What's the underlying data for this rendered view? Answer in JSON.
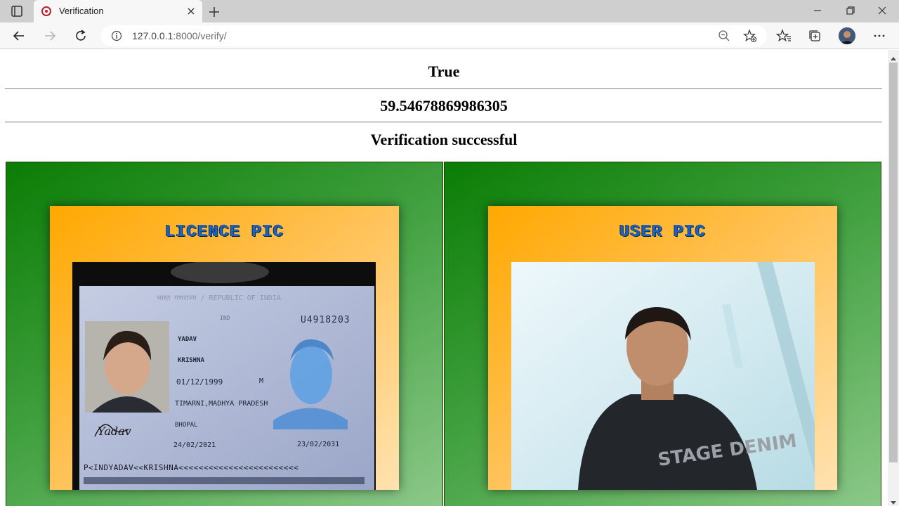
{
  "browser": {
    "tab_title": "Verification",
    "url_host": "127.0.0.1",
    "url_rest": ":8000/verify/"
  },
  "page": {
    "result": "True",
    "score": "59.54678869986305",
    "message": "Verification successful",
    "licence_title": "LICENCE PIC",
    "user_title": "USER PIC"
  },
  "licence_card": {
    "header": "भारत गणराज्य / REPUBLIC OF INDIA",
    "number": "U4918203",
    "surname": "YADAV",
    "given_name": "KRISHNA",
    "dob": "01/12/1999",
    "sex": "M",
    "place_of_birth": "TIMARNI,MADHYA PRADESH",
    "place_of_issue": "BHOPAL",
    "issue_date": "24/02/2021",
    "expiry_date": "23/02/2031",
    "mrz": "P<INDYADAV<<KRISHNA<<<<<<<<<<<<<<<<<<<<<<<<",
    "country": "IND",
    "signature": "Yadav"
  },
  "user_photo": {
    "shirt_text": "STAGE DENIM"
  },
  "colors": {
    "panel_green": "#0a7d05",
    "card_orange": "#ffa800",
    "title_blue": "#1a64c8"
  },
  "icons": [
    "tab-actions-icon",
    "favicon-icon",
    "close-icon",
    "plus-icon",
    "minimize-icon",
    "restore-icon",
    "window-close-icon",
    "back-icon",
    "forward-icon",
    "reload-icon",
    "info-icon",
    "zoom-out-icon",
    "add-favorite-icon",
    "favorites-icon",
    "collections-icon",
    "more-icon"
  ]
}
